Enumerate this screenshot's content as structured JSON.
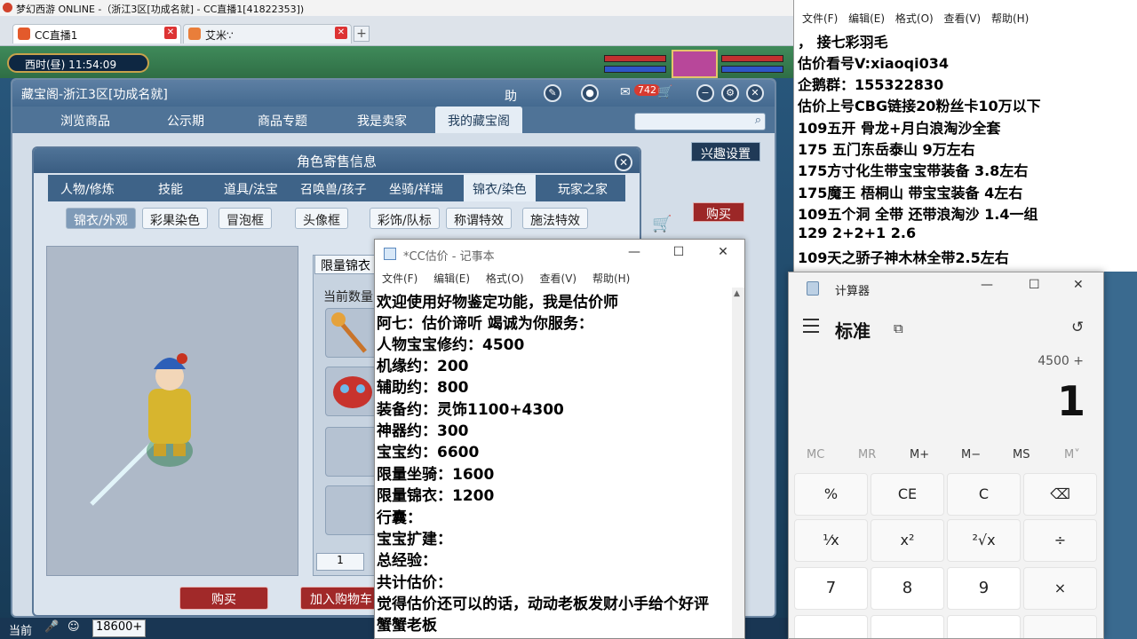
{
  "browser": {
    "title": "梦幻西游 ONLINE -（浙江3区[功成名就] - CC直播1[41822353])",
    "tabs": [
      {
        "label": "CC直播1",
        "active": true
      },
      {
        "label": "艾米∵",
        "active": false
      }
    ],
    "new_tab": "+"
  },
  "game_hud": {
    "clock": "西时(昼)  11:54:09"
  },
  "pavilion": {
    "title": "藏宝阁-浙江3区[功成名就]",
    "help": "助",
    "message_count": "742",
    "nav": [
      "浏览商品",
      "公示期",
      "商品专题",
      "我是卖家",
      "我的藏宝阁"
    ],
    "active_nav": "我的藏宝阁",
    "interest_button": "兴趣设置",
    "buy_button": "购买"
  },
  "role_dialog": {
    "title": "角色寄售信息",
    "tabs": [
      "人物/修炼",
      "技能",
      "道具/法宝",
      "召唤兽/孩子",
      "坐骑/祥瑞",
      "锦衣/染色",
      "玩家之家"
    ],
    "active_tab": "锦衣/染色",
    "subtabs": [
      "锦衣/外观",
      "彩果染色",
      "冒泡框",
      "头像框",
      "彩饰/队标",
      "称谓特效",
      "施法特效"
    ],
    "active_subtab": "锦衣/外观",
    "limit_select": "限量锦衣",
    "count_label": "当前数量",
    "page": "1",
    "buy_button": "购买",
    "cart_button": "加入购物车"
  },
  "statusbar": {
    "label": "当前",
    "input_value": "18600+"
  },
  "notes_back": {
    "menu": [
      "文件(F)",
      "编辑(E)",
      "格式(O)",
      "查看(V)",
      "帮助(H)"
    ],
    "lines": [
      "，    接七彩羽毛",
      "估价看号V:xiaoqi034",
      "企鹅群：155322830",
      "估价上号CBG链接20粉丝卡10万以下",
      "109五开 骨龙+月白浪淘沙全套",
      "175 五门东岳泰山  9万左右",
      "175方寸化生带宝宝带装备  3.8左右",
      "175魔王 梧桐山  带宝宝装备 4左右",
      "109五个洞 全带 还带浪淘沙  1.4一组",
      "129 2+2+1  2.6",
      "109天之骄子神木林全带2.5左右"
    ]
  },
  "notepad": {
    "title": "*CC估价 - 记事本",
    "menu": [
      "文件(F)",
      "编辑(E)",
      "格式(O)",
      "查看(V)",
      "帮助(H)"
    ],
    "lines": [
      "欢迎使用好物鉴定功能，我是估价师",
      "阿七：估价谛听 竭诚为你服务：",
      "人物宝宝修约：4500",
      "机缘约：200",
      "辅助约：800",
      "装备约：灵饰1100+4300",
      "神器约：300",
      "宝宝约：6600",
      "限量坐骑：1600",
      "限量锦衣：1200",
      "行囊：",
      "宝宝扩建：",
      "总经验：",
      "共计估价：",
      "觉得估价还可以的话，动动老板发财小手给个好评",
      "蟹蟹老板"
    ]
  },
  "calculator": {
    "title": "计算器",
    "mode": "标准",
    "expression": "4500 +",
    "display": "1",
    "memory": [
      "MC",
      "MR",
      "M+",
      "M−",
      "MS",
      "M˅"
    ],
    "keys": [
      "%",
      "CE",
      "C",
      "⌫",
      "¹⁄x",
      "x²",
      "²√x",
      "÷",
      "7",
      "8",
      "9",
      "×"
    ]
  }
}
